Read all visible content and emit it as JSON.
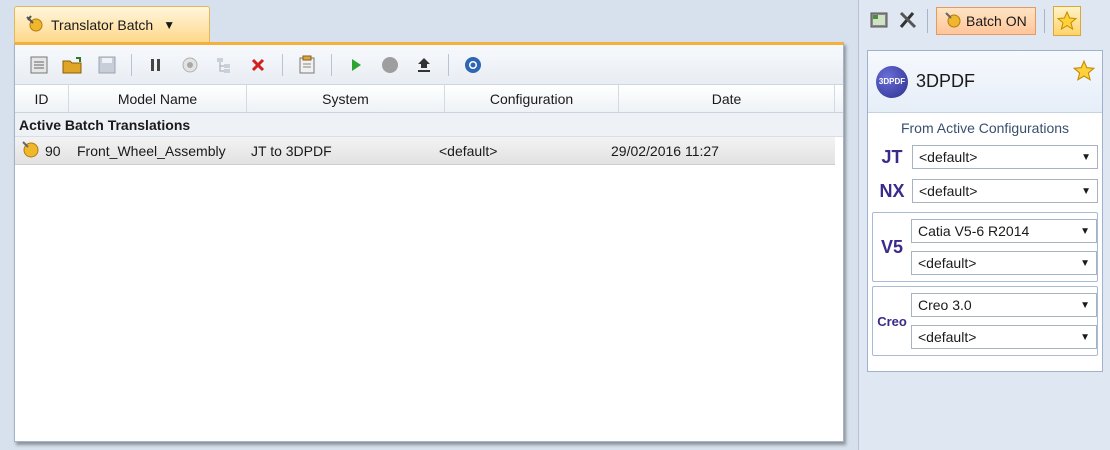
{
  "doc_tab": {
    "label": "Translator Batch",
    "arrow": "▼"
  },
  "grid": {
    "columns": [
      "ID",
      "Model Name",
      "System",
      "Configuration",
      "Date"
    ],
    "group_label": "Active Batch Translations",
    "rows": [
      {
        "id": "90",
        "model": "Front_Wheel_Assembly",
        "system": "JT to 3DPDF",
        "configuration": "<default>",
        "date": "29/02/2016 11:27"
      }
    ]
  },
  "right_toolbar": {
    "batch_label": "Batch ON"
  },
  "side_panel": {
    "title": "3DPDF",
    "badge": "3DPDF",
    "from_label": "From Active Configurations",
    "jt": {
      "label": "JT",
      "value": "<default>"
    },
    "nx": {
      "label": "NX",
      "value": "<default>"
    },
    "v5": {
      "label": "V5",
      "value1": "Catia V5-6 R2014",
      "value2": "<default>"
    },
    "creo": {
      "label": "Creo",
      "value1": "Creo 3.0",
      "value2": "<default>"
    }
  },
  "colors": {
    "tab_accent": "#f3b03d",
    "format_label": "#3b2a8a",
    "batch_on_bg": "#ffc59a"
  }
}
